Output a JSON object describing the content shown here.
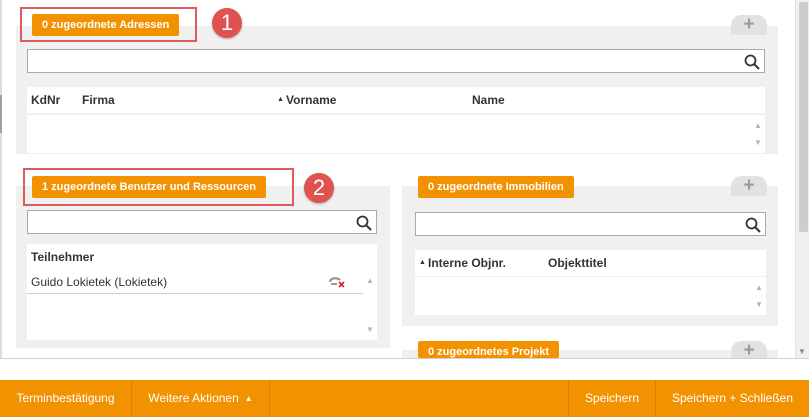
{
  "addresses": {
    "tab_label": "0 zugeordnete Adressen",
    "callout": "1",
    "search_placeholder": "",
    "columns": {
      "kdnr": "KdNr",
      "firma": "Firma",
      "vorname": "Vorname",
      "name": "Name"
    },
    "sort_indicator": "▲"
  },
  "users": {
    "tab_label": "1 zugeordnete Benutzer und Ressourcen",
    "callout": "2",
    "search_placeholder": "",
    "column_header": "Teilnehmer",
    "rows": [
      {
        "label": "Guido Lokietek (Lokietek)"
      }
    ]
  },
  "properties": {
    "tab_label": "0 zugeordnete Immobilien",
    "search_placeholder": "",
    "columns": {
      "internal_no": "Interne Objnr.",
      "title": "Objekttitel"
    },
    "sort_indicator": "▲"
  },
  "project": {
    "tab_label": "0 zugeordnetes Projekt"
  },
  "add_symbol": "+",
  "footer": {
    "confirm_label": "Terminbestätigung",
    "more_actions_label": "Weitere Aktionen",
    "more_actions_caret": "▲",
    "save_label": "Speichern",
    "save_close_label": "Speichern + Schließen"
  },
  "colors": {
    "accent": "#f39200",
    "callout": "#e0524f",
    "panel_bg": "#f0f0f0"
  }
}
